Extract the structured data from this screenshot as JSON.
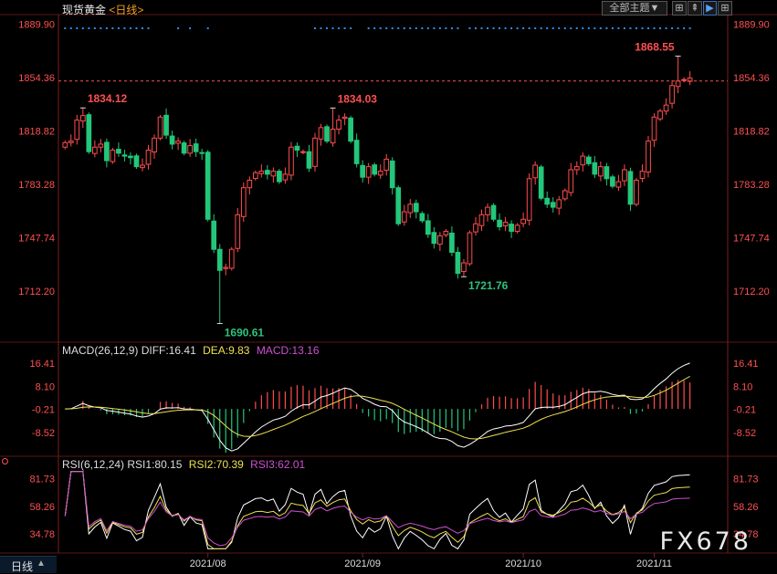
{
  "header": {
    "instrument": "现货黄金",
    "period": "<日线>",
    "dropdown_label": "全部主题▼"
  },
  "macd_header": {
    "label": "MACD(26,12,9)",
    "diff": "DIFF:16.41",
    "dea": "DEA:9.83",
    "macd": "MACD:13.16"
  },
  "rsi_header": {
    "label": "RSI(6,12,24)",
    "rsi1": "RSI1:80.15",
    "rsi2": "RSI2:70.39",
    "rsi3": "RSI3:62.01"
  },
  "footer": {
    "tab_label": "日线"
  },
  "watermark": "FX678",
  "colors": {
    "up": "#ff4d4d",
    "down": "#22c77a",
    "diff_line": "#ffffff",
    "dea_line": "#f0e050",
    "macd_label": "#d050d0",
    "rsi1": "#ffffff",
    "rsi2": "#f0e050",
    "rsi3": "#d050d0",
    "axis_text": "#ff5050",
    "price_label_up": "#ff5050",
    "price_label_down": "#2ec27e",
    "event_dots": "#2a8ff0"
  },
  "chart_data": [
    {
      "type": "candlestick",
      "title": "",
      "y_ticks": [
        "1889.90",
        "1854.36",
        "1818.82",
        "1783.28",
        "1747.74",
        "1712.20"
      ],
      "ylim": [
        1680,
        1895
      ],
      "x_ticks": [
        "2021/08",
        "2021/09",
        "2021/10",
        "2021/11"
      ],
      "reference_line": 1852,
      "annotations": [
        {
          "label": "1834.12",
          "index": 3,
          "kind": "high"
        },
        {
          "label": "1690.61",
          "index": 26,
          "kind": "low"
        },
        {
          "label": "1834.03",
          "index": 45,
          "kind": "high"
        },
        {
          "label": "1721.76",
          "index": 67,
          "kind": "low"
        },
        {
          "label": "1868.55",
          "index": 103,
          "kind": "high"
        }
      ],
      "event_dot_groups": [
        [
          0,
          14
        ],
        [
          19,
          19
        ],
        [
          21,
          21
        ],
        [
          24,
          24
        ],
        [
          42,
          48
        ],
        [
          51,
          66
        ],
        [
          68,
          105
        ]
      ],
      "closes": [
        1811,
        1812,
        1826,
        1829,
        1805,
        1808,
        1810,
        1799,
        1806,
        1804,
        1802,
        1801,
        1795,
        1796,
        1806,
        1814,
        1828,
        1816,
        1810,
        1812,
        1804,
        1809,
        1805,
        1804,
        1760,
        1740,
        1726,
        1728,
        1740,
        1763,
        1781,
        1786,
        1791,
        1792,
        1790,
        1792,
        1785,
        1790,
        1808,
        1806,
        1805,
        1794,
        1814,
        1821,
        1812,
        1820,
        1826,
        1828,
        1812,
        1797,
        1788,
        1795,
        1790,
        1792,
        1800,
        1781,
        1757,
        1765,
        1770,
        1765,
        1759,
        1750,
        1744,
        1749,
        1752,
        1738,
        1724,
        1731,
        1751,
        1757,
        1763,
        1768,
        1760,
        1755,
        1758,
        1752,
        1756,
        1760,
        1787,
        1796,
        1774,
        1770,
        1768,
        1773,
        1779,
        1793,
        1795,
        1802,
        1797,
        1790,
        1795,
        1787,
        1782,
        1785,
        1793,
        1770,
        1786,
        1792,
        1812,
        1828,
        1832,
        1836,
        1849,
        1852,
        1853,
        1854
      ]
    },
    {
      "type": "bar",
      "title": "MACD(26,12,9)",
      "y_ticks": [
        "16.41",
        "8.10",
        "-0.21",
        "-8.52"
      ],
      "ylim": [
        -16,
        19
      ],
      "series": [
        {
          "name": "DIFF",
          "value": 16.41
        },
        {
          "name": "DEA",
          "value": 9.83
        },
        {
          "name": "MACD",
          "value": 13.16
        }
      ]
    },
    {
      "type": "line",
      "title": "RSI(6,12,24)",
      "y_ticks": [
        "81.73",
        "58.26",
        "34.78"
      ],
      "ylim": [
        20,
        90
      ],
      "series": [
        {
          "name": "RSI1",
          "value": 80.15
        },
        {
          "name": "RSI2",
          "value": 70.39
        },
        {
          "name": "RSI3",
          "value": 62.01
        }
      ]
    }
  ]
}
